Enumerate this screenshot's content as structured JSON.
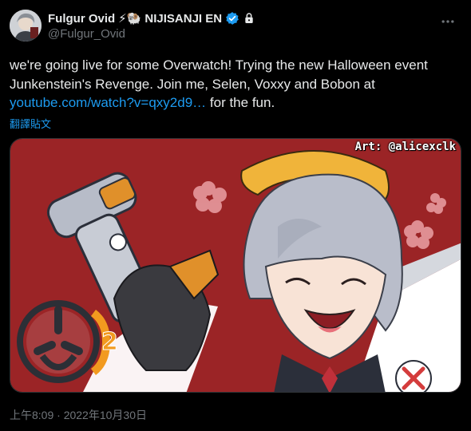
{
  "author": {
    "display_name": "Fulgur Ovid",
    "emoji": "⚡🐏",
    "org": "NIJISANJI EN",
    "handle": "@Fulgur_Ovid",
    "verified_icon": "verified-badge-icon",
    "lock_icon": "lock-icon",
    "verified_color": "#1d9bf0"
  },
  "tweet": {
    "text_before_link": "we're going live for some Overwatch! Trying the new Halloween event Junkenstein's Revenge. Join me, Selen, Voxxy and Bobon at ",
    "link_text": "youtube.com/watch?v=qxy2d9…",
    "text_after_link": " for the fun.",
    "translate_label": "翻譯貼文"
  },
  "media": {
    "art_credit": "Art: @alicexclk",
    "logo": "overwatch-2-logo",
    "background_color": "#9b2426"
  },
  "meta": {
    "timestamp": "上午8:09 · 2022年10月30日"
  },
  "colors": {
    "link": "#1d9bf0",
    "muted": "#71767b",
    "text": "#e7e9ea",
    "background": "#000000"
  }
}
